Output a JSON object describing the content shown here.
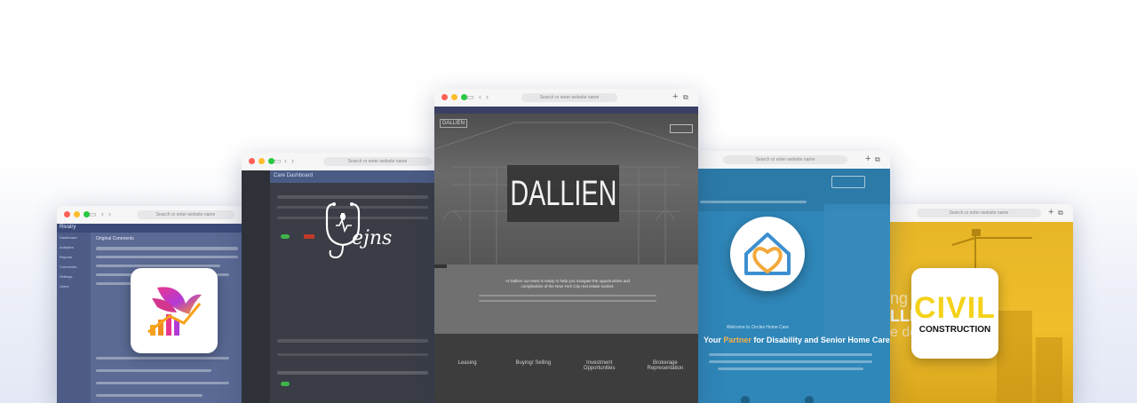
{
  "windows": {
    "w1": {
      "url_placeholder": "Search or enter website name",
      "app_name": "Rivalry",
      "page_title": "Original Comments",
      "sidebar_items": [
        "Dashboard",
        "Analytics",
        "Reports",
        "Comments",
        "Settings",
        "Users"
      ]
    },
    "w2": {
      "url_placeholder": "Search or enter website name",
      "page_title": "Care Dashboard",
      "logo_text": "ejns"
    },
    "w3": {
      "url_placeholder": "Search or enter website name",
      "brand": "DALLIEN",
      "small_brand": "DALLIEN",
      "tagline": "At Dallien our team is ready to help you navigate the opportunities and complexities of the New York City real estate market.",
      "services": [
        "Leasing",
        "Buying/ Selling",
        "Investment Opportunities",
        "Brokerage Representation"
      ]
    },
    "w4": {
      "url_placeholder": "Search or enter website name",
      "welcome": "Welcome to Circles Home Care",
      "headline_prefix": "Your",
      "headline_accent": "Partner",
      "headline_suffix": "for Disability and Senior Home Care"
    },
    "w5": {
      "url_placeholder": "Search or enter website name",
      "logo_line1": "CIVIL",
      "logo_line2": "CONSTRUCTION",
      "hero_partial1": "ng",
      "hero_partial2": "LLEN",
      "hero_partial3": "e do"
    }
  },
  "colors": {
    "bg": "#ffffff",
    "civil_yellow": "#f0b81c",
    "civil_logo_yellow": "#f4d21a",
    "homecare_blue": "#2f86b8"
  }
}
